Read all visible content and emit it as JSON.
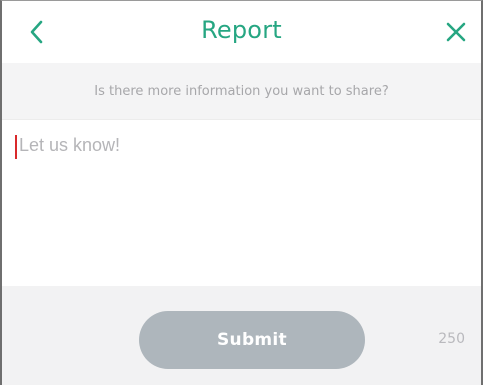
{
  "header": {
    "title": "Report",
    "back_icon": "chevron-left-icon",
    "close_icon": "close-icon",
    "accent_color": "#26a682"
  },
  "subheader": {
    "prompt": "Is there more information you want to share?"
  },
  "input": {
    "placeholder": "Let us know!",
    "value": ""
  },
  "footer": {
    "submit_label": "Submit",
    "char_count": "250",
    "submit_color": "#aeb6bc"
  }
}
